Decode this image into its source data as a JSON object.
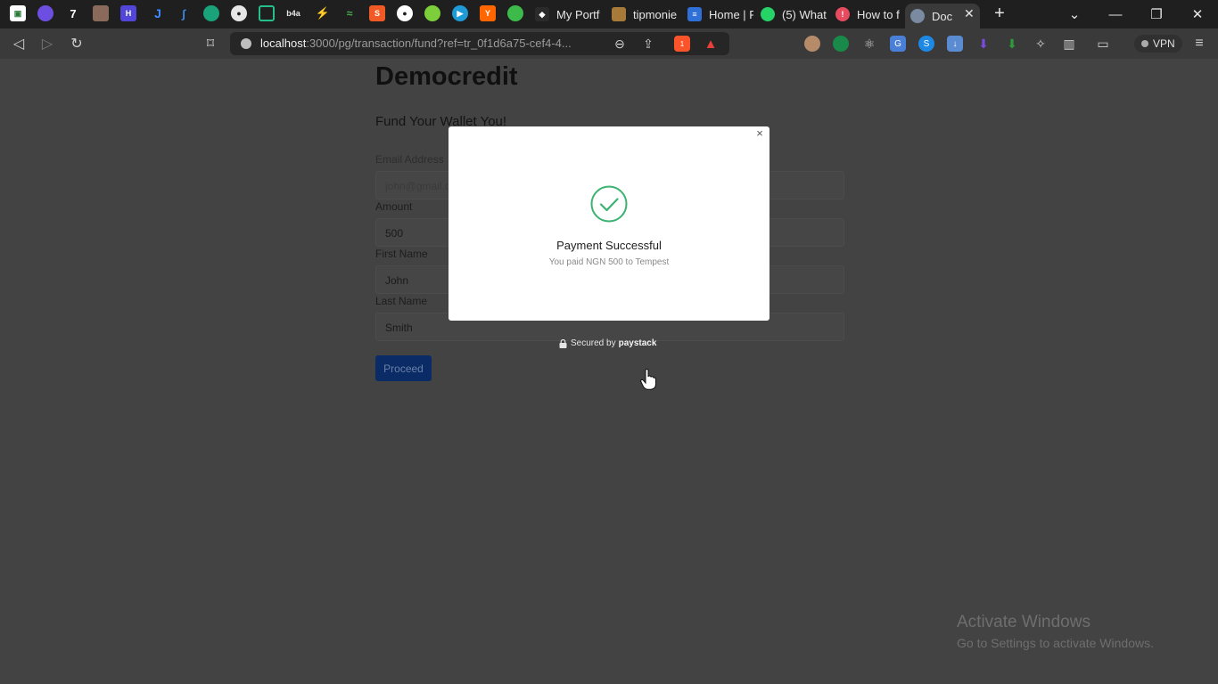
{
  "browser": {
    "tabs": [
      {
        "title": "My Portf",
        "color": "#2b2b2b"
      },
      {
        "title": "tipmonie",
        "color": "#a87a3a"
      },
      {
        "title": "Home | F",
        "color": "#2e6fd8"
      },
      {
        "title": "(5) What",
        "color": "#25d366"
      },
      {
        "title": "How to f",
        "color": "#e64b5f"
      }
    ],
    "active_tab": {
      "title": "Doc",
      "color": "#7a8aa0"
    },
    "url_host": "localhost",
    "url_rest": ":3000/pg/transaction/fund?ref=tr_0f1d6a75-cef4-4...",
    "vpn_label": "VPN",
    "brave_count": "1"
  },
  "page": {
    "brand": "Democredit",
    "subtitle": "Fund Your Wallet You!",
    "fields": {
      "email_label": "Email Address",
      "email_placeholder": "john@gmail.c",
      "amount_label": "Amount",
      "amount_value": "500",
      "first_name_label": "First Name",
      "first_name_value": "John",
      "last_name_label": "Last Name",
      "last_name_value": "Smith"
    },
    "proceed_label": "Proceed"
  },
  "modal": {
    "close_glyph": "×",
    "title": "Payment Successful",
    "message": "You paid NGN 500 to Tempest",
    "success_color": "#3cb371"
  },
  "secured": {
    "prefix": "Secured by",
    "brand": "paystack"
  },
  "windows_notice": {
    "title": "Activate Windows",
    "message": "Go to Settings to activate Windows."
  }
}
